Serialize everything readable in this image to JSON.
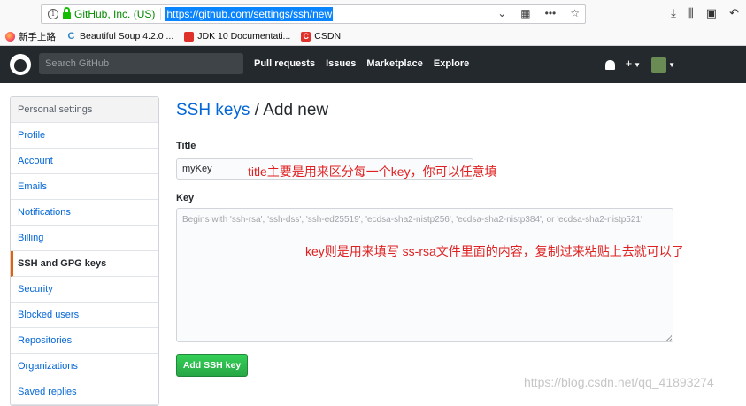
{
  "browser": {
    "identity": "GitHub, Inc. (US)",
    "url": "https://github.com/settings/ssh/new",
    "url_icons": [
      "qr-code-icon",
      "more-icon",
      "bookmark-star-icon"
    ],
    "bookmarks": [
      {
        "label": "新手上路",
        "icon": "firefox-icon"
      },
      {
        "label": "Beautiful Soup 4.2.0 ...",
        "icon": "c-icon"
      },
      {
        "label": "JDK 10 Documentati...",
        "icon": "red-icon"
      },
      {
        "label": "CSDN",
        "icon": "csdn-icon"
      }
    ]
  },
  "header": {
    "search_placeholder": "Search GitHub",
    "nav": [
      "Pull requests",
      "Issues",
      "Marketplace",
      "Explore"
    ],
    "bg_color": "#24292e"
  },
  "sidebar": {
    "heading": "Personal settings",
    "items": [
      {
        "label": "Profile",
        "selected": false
      },
      {
        "label": "Account",
        "selected": false
      },
      {
        "label": "Emails",
        "selected": false
      },
      {
        "label": "Notifications",
        "selected": false
      },
      {
        "label": "Billing",
        "selected": false
      },
      {
        "label": "SSH and GPG keys",
        "selected": true
      },
      {
        "label": "Security",
        "selected": false
      },
      {
        "label": "Blocked users",
        "selected": false
      },
      {
        "label": "Repositories",
        "selected": false
      },
      {
        "label": "Organizations",
        "selected": false
      },
      {
        "label": "Saved replies",
        "selected": false
      }
    ]
  },
  "main": {
    "crumb": "SSH keys",
    "title_rest": " / Add new",
    "title_label": "Title",
    "title_value": "myKey",
    "key_label": "Key",
    "key_placeholder": "Begins with 'ssh-rsa', 'ssh-dss', 'ssh-ed25519', 'ecdsa-sha2-nistp256', 'ecdsa-sha2-nistp384', or 'ecdsa-sha2-nistp521'",
    "add_button": "Add SSH key",
    "button_color": "#28a745"
  },
  "annotations": {
    "title_note": "title主要是用来区分每一个key，你可以任意填",
    "key_note": "key则是用来填写  ss-rsa文件里面的内容，复制过来粘贴上去就可以了",
    "color": "#e02020"
  },
  "watermark": "https://blog.csdn.net/qq_41893274"
}
